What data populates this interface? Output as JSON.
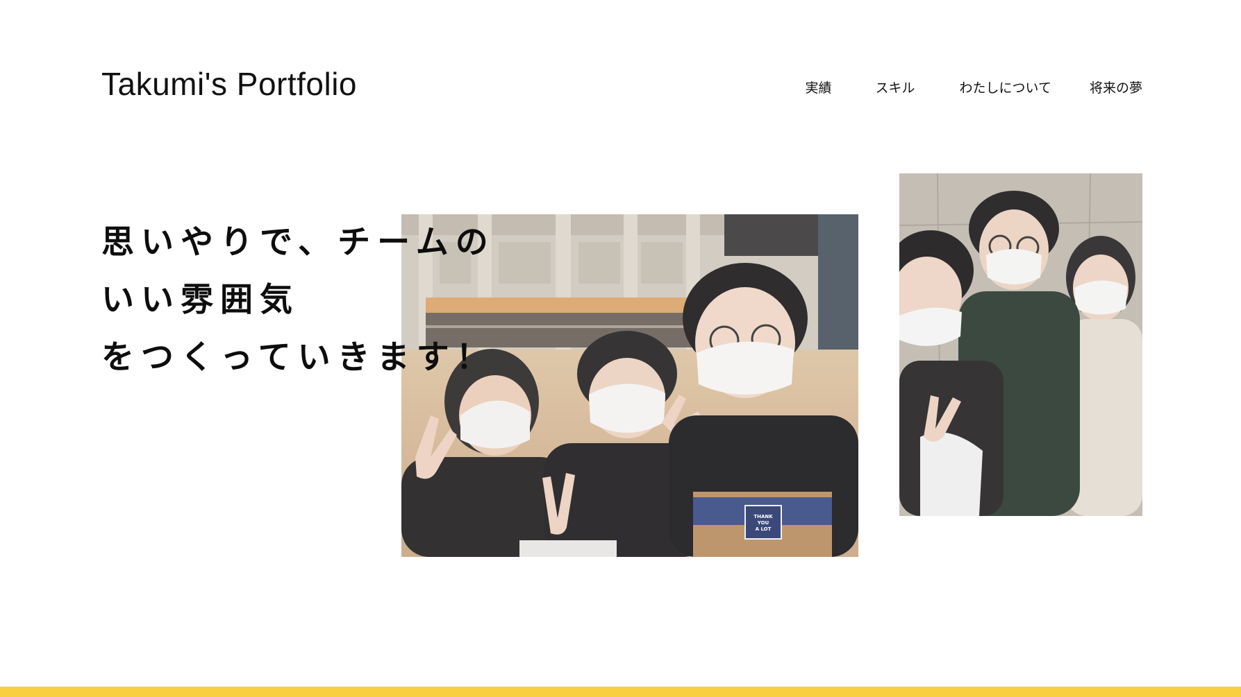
{
  "header": {
    "site_title": "Takumi's Portfolio",
    "nav": [
      {
        "label": "実績"
      },
      {
        "label": "スキル"
      },
      {
        "label": "わたしについて"
      },
      {
        "label": "将来の夢"
      }
    ]
  },
  "hero": {
    "headline_lines": [
      "思いやりで、チームの",
      "いい雰囲気",
      "をつくっていきます！"
    ],
    "main_photo": {
      "bag_label": "THANK YOU A LOT"
    }
  },
  "colors": {
    "accent_bar": "#f9cf3f",
    "text": "#111111",
    "background": "#ffffff"
  }
}
